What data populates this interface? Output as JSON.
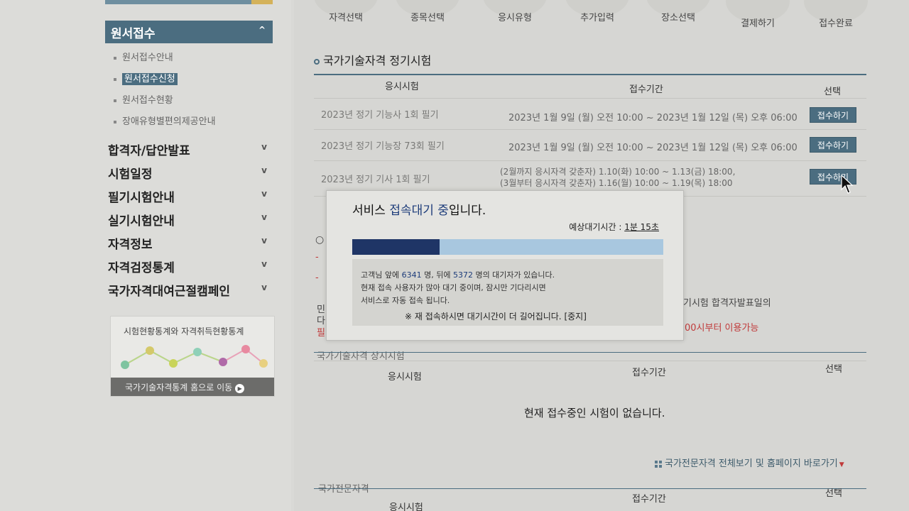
{
  "sidebar": {
    "section_header": "원서접수",
    "sub_items": [
      {
        "label": "원서접수안내",
        "active": false
      },
      {
        "label": "원서접수신청",
        "active": true
      },
      {
        "label": "원서접수현황",
        "active": false
      },
      {
        "label": "장애유형별편의제공안내",
        "active": false
      }
    ],
    "nav_items": [
      {
        "label": "합격자/답안발표"
      },
      {
        "label": "시험일정"
      },
      {
        "label": "필기시험안내"
      },
      {
        "label": "실기시험안내"
      },
      {
        "label": "자격정보"
      },
      {
        "label": "자격검정통계"
      },
      {
        "label": "국가자격대여근절캠페인"
      }
    ],
    "stats_box": {
      "title": "시험현황통계와 자격취득현황통계",
      "link": "국가기술자격통계 홈으로 이동"
    }
  },
  "steps": [
    "자격선택",
    "종목선택",
    "응시유형",
    "추가입력",
    "장소선택",
    "결제하기",
    "접수완료"
  ],
  "regular": {
    "title": "국가기술자격 정기시험",
    "headers": {
      "exam": "응시시험",
      "period": "접수기간",
      "select": "선택"
    },
    "rows": [
      {
        "name": "2023년 정기 기능사 1회 필기",
        "period": "2023년 1월 9일 (월) 오전 10:00 ~ 2023년 1월 12일 (목) 오후 06:00",
        "button": "접수하기"
      },
      {
        "name": "2023년 정기 기능장 73회 필기",
        "period": "2023년 1월 9일 (월) 오전 10:00 ~ 2023년 1월 12일 (목) 오후 06:00",
        "button": "접수하기"
      },
      {
        "name": "2023년 정기 기사 1회 필기",
        "period_line1": "(2월까지 응시자격 갖춘자) 1.10(화) 10:00 ~ 1.13(금) 18:00,",
        "period_line2": "(3월부터 응시자격 갖춘자) 1.16(월) 10:00 ~ 1.19(목) 18:00",
        "button": "접수하기"
      }
    ]
  },
  "background_fragments": {
    "right_notice": "기시험 합격자발표일의",
    "right_red": "00시부터 이용가능",
    "left_frag_1": "민",
    "left_frag_2": "다",
    "left_frag_3": "필",
    "dash_1": "-",
    "dash_2": "-"
  },
  "permanent": {
    "title": "국가기술자격 상시시험",
    "headers": {
      "exam": "응시시험",
      "period": "접수기간",
      "select": "선택"
    },
    "empty_message": "현재 접수중인 시험이 없습니다."
  },
  "professional": {
    "shortcut": "국가전문자격 전체보기 및 홈페이지 바로가기",
    "title": "국가전문자격",
    "headers": {
      "exam": "응시시험",
      "period": "접수기간",
      "select": "선택"
    }
  },
  "modal": {
    "title_prefix": "서비스 ",
    "title_highlight": "접속대기 중",
    "title_suffix": "입니다.",
    "wait_label": "예상대기시간 : ",
    "wait_time": "1분 15초",
    "progress": 0.28,
    "line1_prefix": "고객님 앞에 ",
    "ahead_count": "6341",
    "line1_mid": " 명, 뒤에 ",
    "behind_count": "5372",
    "line1_suffix": " 명의 대기자가 있습니다.",
    "line2": "현재 접속 사용자가 많아 대기 중이며, 잠시만 기다리시면",
    "line3": "서비스로 자동 접속 됩니다.",
    "notice": "※ 재 접속하시면 대기시간이 더 길어집니다.",
    "stop_label": "[중지]"
  },
  "colors": {
    "accent": "#4b6d80",
    "progress_fill": "#1f3566",
    "progress_track": "#a8c7df",
    "red_text": "#c03a3a"
  }
}
